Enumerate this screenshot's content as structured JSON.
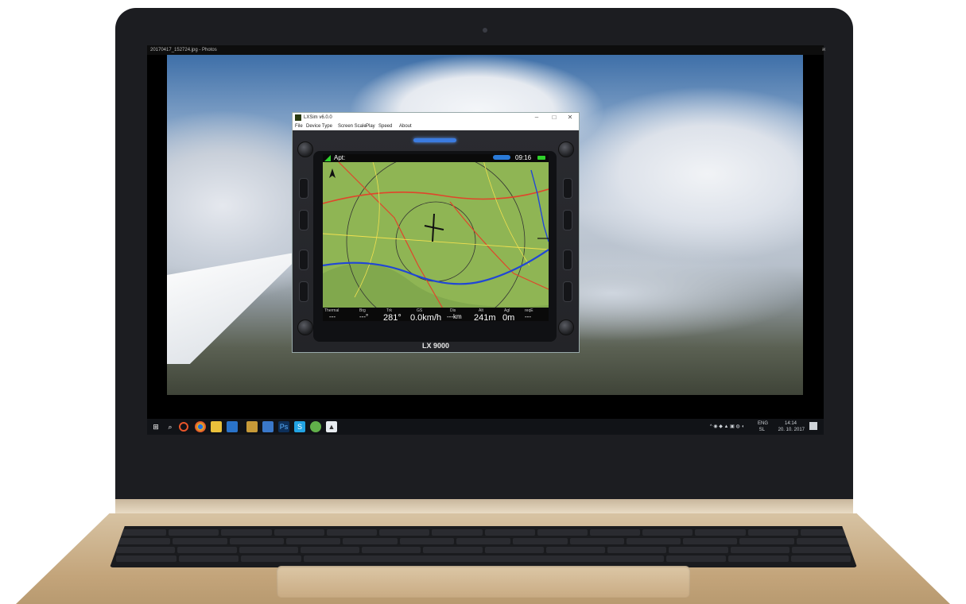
{
  "photos_window": {
    "title": "20170417_152724.jpg - Photos",
    "controls": [
      "–",
      "□",
      "✕"
    ]
  },
  "lxsim_window": {
    "title": "LXSim v6.0.0",
    "menu": [
      "File",
      "Device Type",
      "Screen Scale",
      "Play",
      "Speed",
      "About"
    ],
    "controls": [
      "–",
      "□",
      "✕"
    ],
    "device_name": "LX 9000",
    "lcd": {
      "mode_label": "Apt:",
      "time": "09:16",
      "navboxes": [
        {
          "label": "Thermal",
          "value": "---"
        },
        {
          "label": "Brg",
          "value": "---°"
        },
        {
          "label": "Trk",
          "value": "281°"
        },
        {
          "label": "GS",
          "value": "0.0km/h"
        },
        {
          "label": "Dis",
          "value": "---km"
        },
        {
          "label": "Alt",
          "value": "241m"
        },
        {
          "label": "Agl",
          "value": "0m"
        },
        {
          "label": "reqE",
          "value": "---"
        }
      ],
      "colors": {
        "terrain": "#8fb554",
        "road": "#e0452b",
        "river": "#2046d6",
        "airspace": "#d9d9d9",
        "status_green": "#2fd12b",
        "glider_blue": "#2a7ad8"
      }
    }
  },
  "taskbar": {
    "icons": [
      "windows-start-icon",
      "search-icon",
      "cortana-icon",
      "chrome-icon",
      "file-explorer-icon",
      "store-icon",
      "folder-icon",
      "app-icon",
      "photoshop-icon",
      "skype-icon",
      "maps-icon",
      "photos-icon"
    ],
    "tray": {
      "lang": "ENG",
      "region": "SL",
      "time": "14:14",
      "date": "20. 10. 2017"
    }
  }
}
